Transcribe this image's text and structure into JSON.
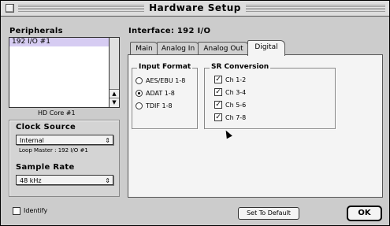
{
  "window": {
    "title": "Hardware Setup"
  },
  "peripherals": {
    "label": "Peripherals",
    "items": [
      "192 I/O #1"
    ],
    "caption": "HD Core #1"
  },
  "interface": {
    "label": "Interface: 192 I/O"
  },
  "tabs": [
    {
      "label": "Main"
    },
    {
      "label": "Analog In"
    },
    {
      "label": "Analog Out"
    },
    {
      "label": "Digital"
    }
  ],
  "active_tab": "Digital",
  "clock": {
    "label": "Clock Source",
    "value": "Internal",
    "loop_master": "Loop Master : 192 I/O #1"
  },
  "sample_rate": {
    "label": "Sample Rate",
    "value": "48 kHz"
  },
  "input_format": {
    "label": "Input Format",
    "options": [
      "AES/EBU 1-8",
      "ADAT 1-8",
      "TDIF 1-8"
    ],
    "selected": "ADAT 1-8"
  },
  "sr_conversion": {
    "label": "SR Conversion",
    "channels": [
      "Ch 1-2",
      "Ch 3-4",
      "Ch 5-6",
      "Ch 7-8"
    ],
    "checked": [
      true,
      true,
      true,
      true
    ]
  },
  "identify": {
    "label": "Identify",
    "checked": false
  },
  "buttons": {
    "set_default": "Set To Default",
    "ok": "OK"
  }
}
